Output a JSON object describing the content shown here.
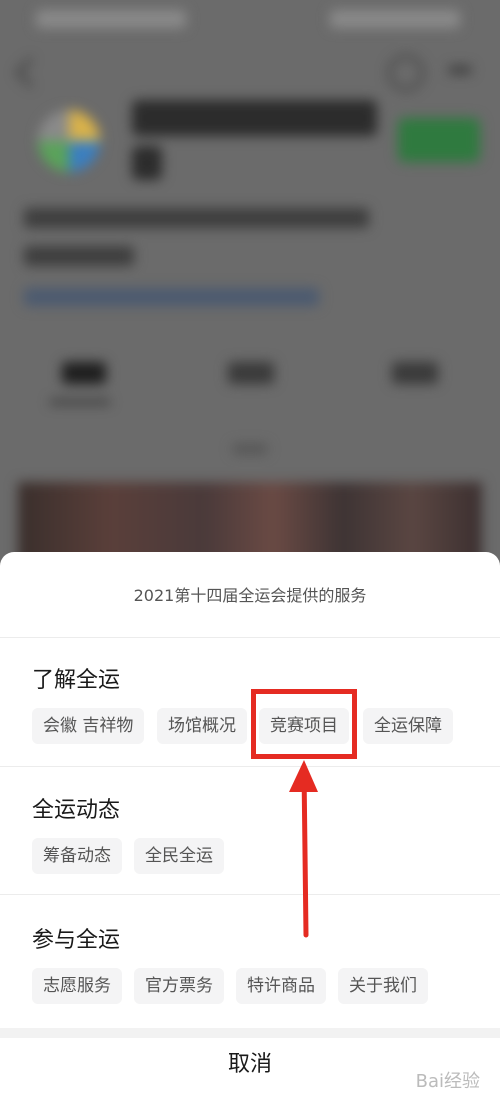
{
  "sheet": {
    "title": "2021第十四届全运会提供的服务",
    "cancel_label": "取消"
  },
  "sections": [
    {
      "title": "了解全运",
      "chips": [
        "会徽 吉祥物",
        "场馆概况",
        "竞赛项目",
        "全运保障"
      ]
    },
    {
      "title": "全运动态",
      "chips": [
        "筹备动态",
        "全民全运"
      ]
    },
    {
      "title": "参与全运",
      "chips": [
        "志愿服务",
        "官方票务",
        "特许商品",
        "关于我们"
      ]
    }
  ],
  "annotation": {
    "color": "#e52b22"
  },
  "watermark": "Bai经验"
}
